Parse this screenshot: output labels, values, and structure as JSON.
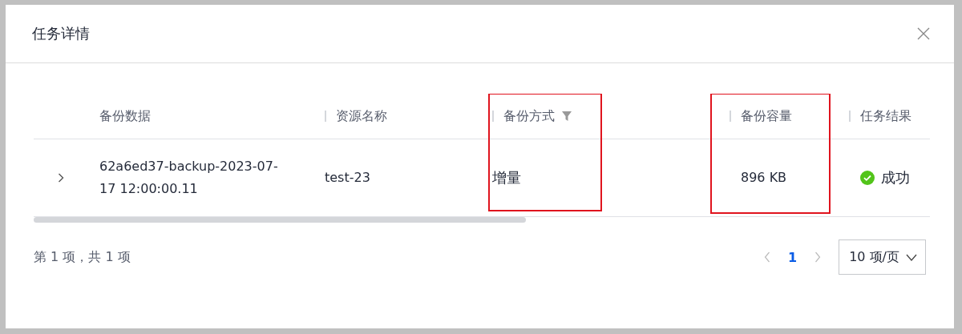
{
  "dialog": {
    "title": "任务详情"
  },
  "table": {
    "columns": [
      {
        "label": "备份数据",
        "filterable": false,
        "highlighted": false
      },
      {
        "label": "资源名称",
        "filterable": false,
        "highlighted": false
      },
      {
        "label": "备份方式",
        "filterable": true,
        "highlighted": true
      },
      {
        "label": "备份容量",
        "filterable": false,
        "highlighted": true
      },
      {
        "label": "任务结果",
        "filterable": false,
        "highlighted": false
      }
    ],
    "rows": [
      {
        "expanded": false,
        "cells": [
          "62a6ed37-backup-2023-07-17 12:00:00.11",
          "test-23",
          "增量",
          "896 KB"
        ],
        "result": {
          "kind": "success",
          "label": "成功"
        }
      }
    ]
  },
  "footer": {
    "summary": "第 1 项，共 1 项",
    "pages": [
      {
        "label": "1",
        "selected": true
      }
    ],
    "page_size": "10 项/页"
  }
}
